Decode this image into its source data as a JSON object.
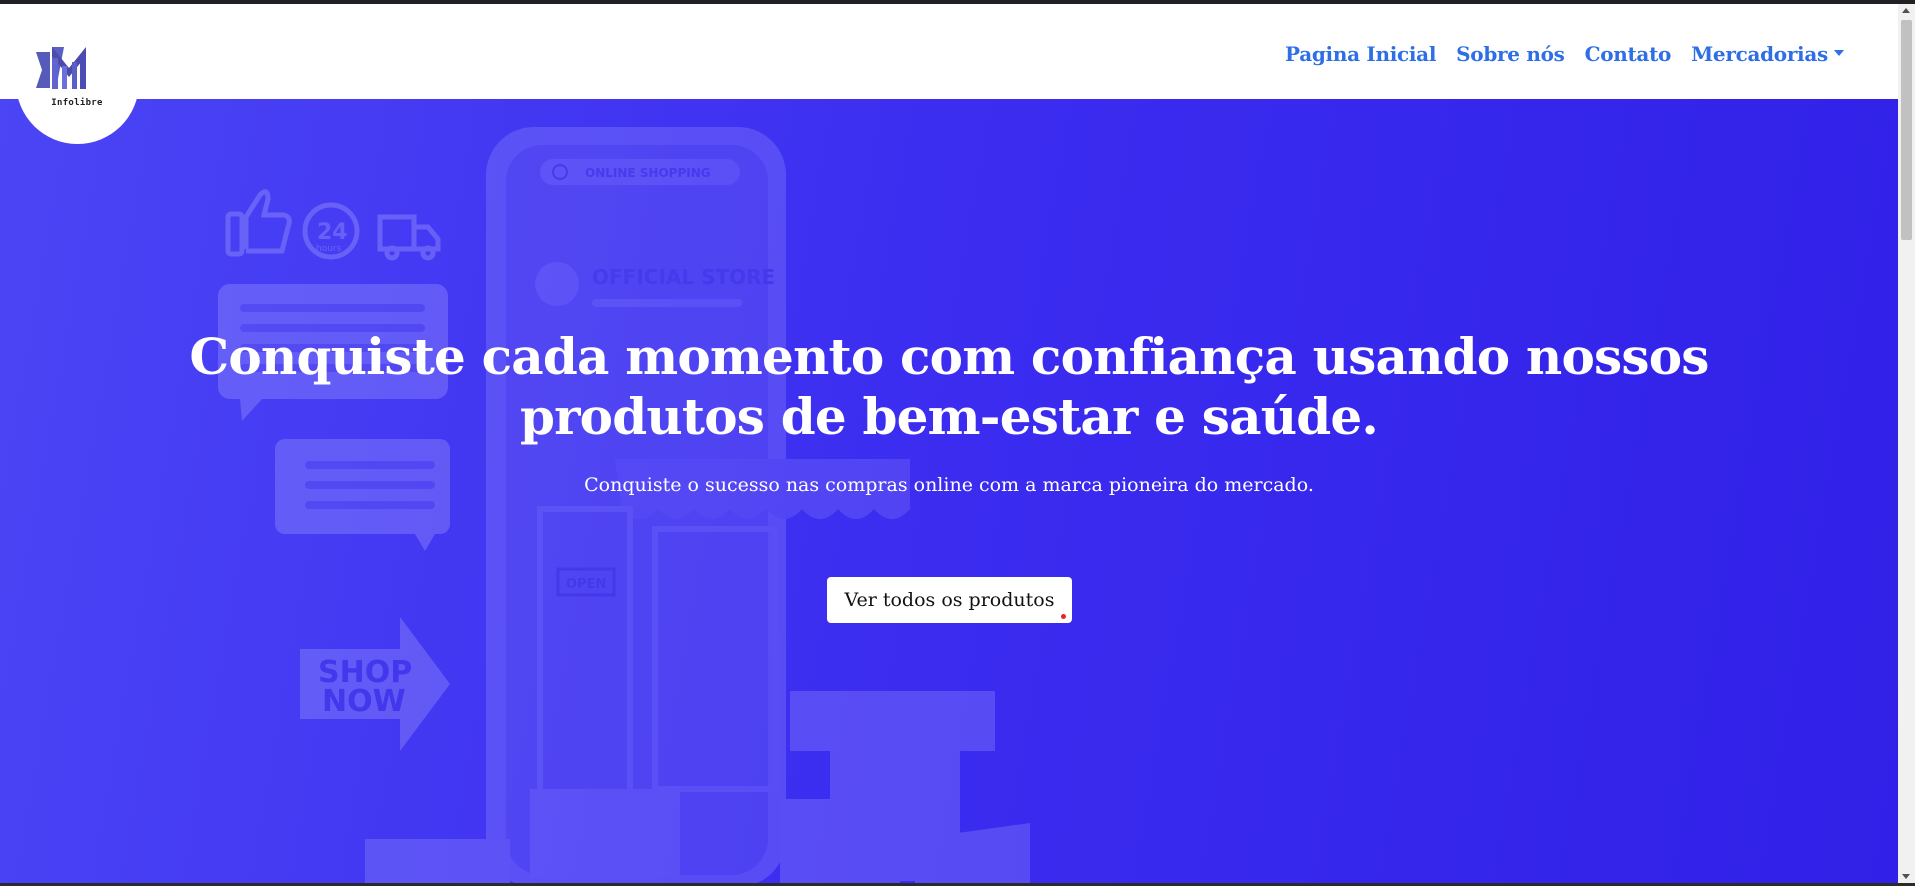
{
  "brand": {
    "name": "Infolibre",
    "icon": "logo-mark-icon"
  },
  "nav": {
    "items": [
      {
        "label": "Pagina Inicial"
      },
      {
        "label": "Sobre nós"
      },
      {
        "label": "Contato"
      },
      {
        "label": "Mercadorias",
        "dropdown": true
      }
    ]
  },
  "hero": {
    "title": "Conquiste cada momento com confiança usando nossos produtos de bem-estar e saúde.",
    "subtitle": "Conquiste o sucesso nas compras online com a marca pioneira do mercado.",
    "cta_label": "Ver todos os produtos",
    "illustration": {
      "search_text": "ONLINE SHOPPING",
      "store_text": "OFFICIAL STORE",
      "open_sign": "OPEN",
      "shop_now_line1": "SHOP",
      "shop_now_line2": "NOW",
      "hours_badge": "24",
      "hours_label": "hours"
    }
  },
  "colors": {
    "nav_link": "#2f6fe6",
    "hero_bg": "#3b2cf0",
    "hero_text": "#ffffff"
  }
}
